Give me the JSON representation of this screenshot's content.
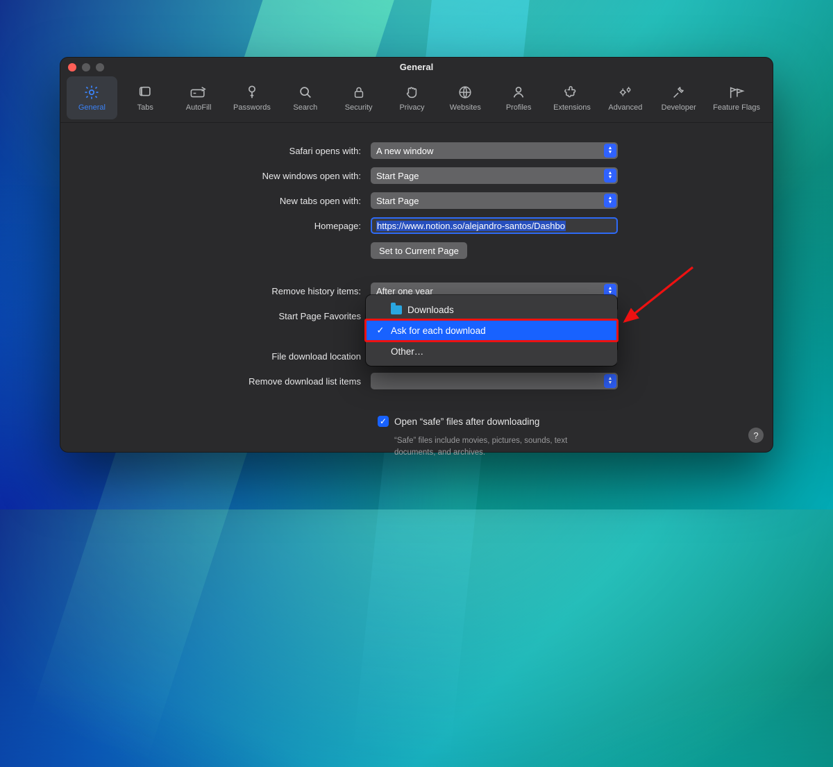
{
  "window": {
    "title": "General"
  },
  "toolbar": {
    "items": [
      {
        "label": "General"
      },
      {
        "label": "Tabs"
      },
      {
        "label": "AutoFill"
      },
      {
        "label": "Passwords"
      },
      {
        "label": "Search"
      },
      {
        "label": "Security"
      },
      {
        "label": "Privacy"
      },
      {
        "label": "Websites"
      },
      {
        "label": "Profiles"
      },
      {
        "label": "Extensions"
      },
      {
        "label": "Advanced"
      },
      {
        "label": "Developer"
      },
      {
        "label": "Feature Flags"
      }
    ]
  },
  "labels": {
    "opensWith": "Safari opens with:",
    "newWindows": "New windows open with:",
    "newTabs": "New tabs open with:",
    "homepage": "Homepage:",
    "setCurrent": "Set to Current Page",
    "removeHistory": "Remove history items:",
    "startPageFav": "Start Page Favorites",
    "fileDownloadLoc": "File download location",
    "removeDownloads": "Remove download list items",
    "openSafe": "Open “safe” files after downloading",
    "safeHint": "“Safe” files include movies, pictures, sounds, text documents, and archives."
  },
  "values": {
    "opensWith": "A new window",
    "newWindows": "Start Page",
    "newTabs": "Start Page",
    "homepage": "https://www.notion.so/alejandro-santos/Dashbo",
    "removeHistory": "After one year"
  },
  "popup": {
    "items": [
      {
        "label": "Downloads"
      },
      {
        "label": "Ask for each download"
      },
      {
        "label": "Other…"
      }
    ]
  },
  "help": {
    "glyph": "?"
  }
}
